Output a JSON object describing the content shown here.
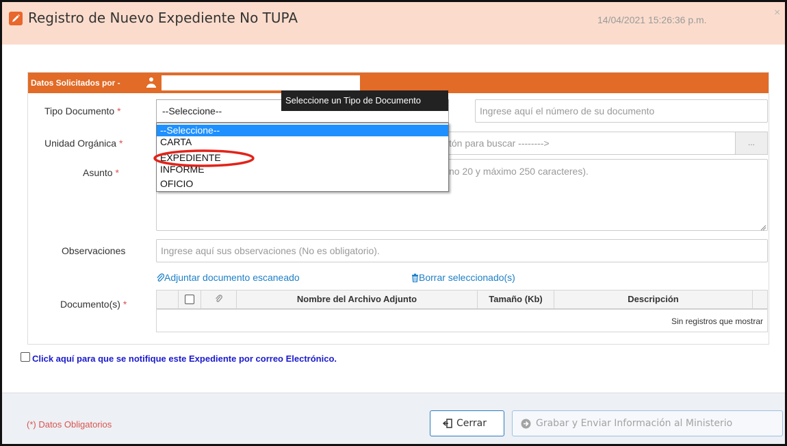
{
  "dialog": {
    "title": "Registro de Nuevo Expediente No TUPA",
    "datetime": "14/04/2021 15:26:36 p.m.",
    "close_glyph": "×",
    "accent_color": "#e16b27",
    "header_bg": "#fbdccc"
  },
  "section": {
    "label": "Datos Solicitados por -",
    "user_icon": "user-icon",
    "user_value": ""
  },
  "form": {
    "tipo_documento": {
      "label": "Tipo Documento",
      "required_mark": "*",
      "selected": "--Seleccione--",
      "options": [
        "--Seleccione--",
        "CARTA",
        "EXPEDIENTE",
        "INFORME",
        "OFICIO"
      ],
      "tooltip": "Seleccione un Tipo de Documento"
    },
    "numero_documento": {
      "placeholder": "Ingrese aquí el número de su documento"
    },
    "unidad_organica": {
      "label": "Unidad Orgánica",
      "required_mark": "*",
      "placeholder_visible": "tón para buscar -------->",
      "browse_button": "..."
    },
    "asunto": {
      "label": "Asunto",
      "required_mark": "*",
      "placeholder_visible": "no 20 y máximo 250 caracteres)."
    },
    "observaciones": {
      "label": "Observaciones",
      "placeholder": "Ingrese aquí sus observaciones (No es obligatorio)."
    },
    "attach_link": "Adjuntar documento escaneado",
    "delete_link": "Borrar seleccionado(s)",
    "documentos": {
      "label": "Documento(s)",
      "required_mark": "*",
      "columns": [
        "Nombre del Archivo Adjunto",
        "Tamaño (Kb)",
        "Descripción"
      ],
      "empty_message": "Sin registros que mostrar"
    }
  },
  "notify": {
    "label": "Click aquí para que se notifique este Expediente por correo Electrónico."
  },
  "footer": {
    "required_note": "(*) Datos Obligatorios",
    "close_button": "Cerrar",
    "save_button": "Grabar y Enviar Información al Ministerio"
  },
  "annotation": {
    "highlighted_option": "EXPEDIENTE",
    "color": "#e2231a"
  }
}
